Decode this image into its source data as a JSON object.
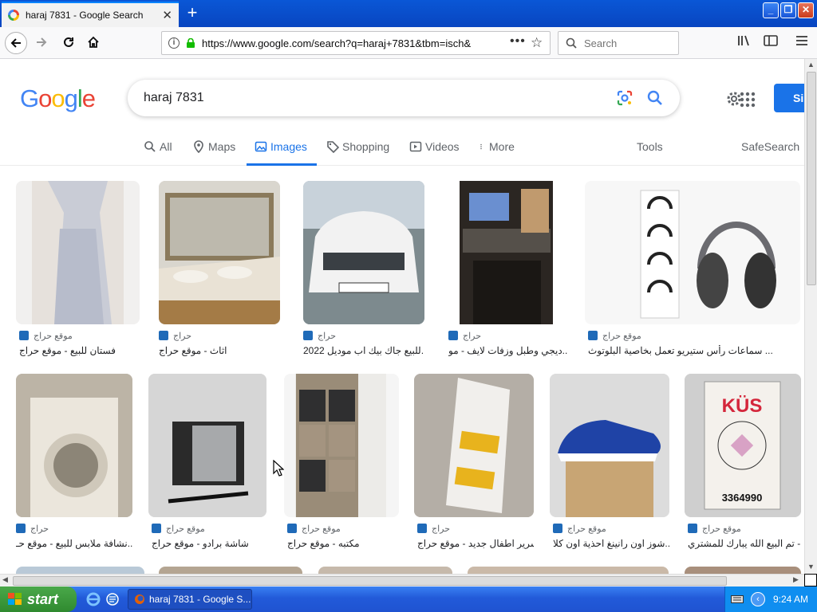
{
  "browser": {
    "tab_title": "haraj 7831 - Google Search",
    "url": "https://www.google.com/search?q=haraj+7831&tbm=isch&",
    "search_placeholder": "Search"
  },
  "google": {
    "query": "haraj 7831",
    "signin_label": "Si",
    "tabs": [
      {
        "label": "All"
      },
      {
        "label": "Maps"
      },
      {
        "label": "Images"
      },
      {
        "label": "Shopping"
      },
      {
        "label": "Videos"
      },
      {
        "label": "More"
      }
    ],
    "tools_label": "Tools",
    "safesearch_label": "SafeSearch"
  },
  "results_row1": [
    {
      "source": "موقع حراج",
      "caption": "فستان للبيع - موقع حراج"
    },
    {
      "source": "حراج",
      "caption": "اثاث - موقع حراج"
    },
    {
      "source": "حراج",
      "caption": "للبيع جاك بيك اب موديل 2022..."
    },
    {
      "source": "حراج",
      "caption": "ديجي وطبل وزفات لايف - مو..."
    },
    {
      "source": "موقع حراج",
      "caption": "سماعات رأس ستيريو تعمل بخاصية البلوتوث ..."
    }
  ],
  "results_row2": [
    {
      "source": "حراج",
      "caption": "نشافة ملابس للبيع - موقع حـ..."
    },
    {
      "source": "موقع حراج",
      "caption": "شاشة برادو - موقع حراج"
    },
    {
      "source": "موقع حراج",
      "caption": "مكتبه - موقع حراج"
    },
    {
      "source": "حراج",
      "caption": "سرير اطفال جديد - موقع حراج"
    },
    {
      "source": "موقع حراج",
      "caption": "شوز اون رانينغ احذية اون كلا..."
    },
    {
      "source": "موقع حراج",
      "caption": "تم البيع الله يبارك للمشتري -..."
    }
  ],
  "taskbar": {
    "start_label": "start",
    "task_label": "haraj 7831 - Google S...",
    "clock": "9:24 AM"
  },
  "colors": {
    "accent": "#1a73e8",
    "titlebar": "#0a57d6",
    "taskbar": "#225ad9",
    "start": "#3a9a3a"
  }
}
